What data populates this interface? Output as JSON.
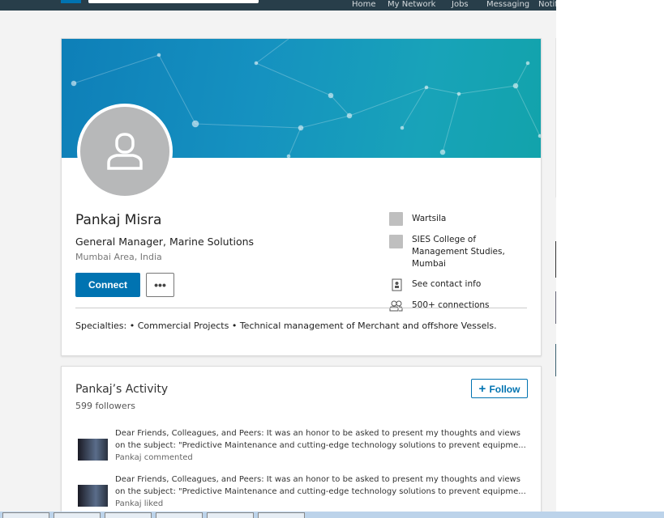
{
  "nav": {
    "items": [
      "Home",
      "My Network",
      "Jobs",
      "Messaging",
      "Notifi"
    ]
  },
  "profile": {
    "name": "Pankaj Misra",
    "headline": "General Manager, Marine Solutions",
    "location": "Mumbai Area, India",
    "connect_label": "Connect",
    "more_label": "•••",
    "company": "Wartsila",
    "school": "SIES College of Management Studies, Mumbai",
    "contact": "See contact info",
    "connections": "500+ connections",
    "specialties": "Specialties: • Commercial Projects • Technical management of Merchant and offshore Vessels."
  },
  "activity": {
    "title": "Pankaj’s Activity",
    "followers": "599 followers",
    "follow_label": "Follow",
    "items": [
      {
        "line1": "Dear Friends, Colleagues, and Peers:  It was an honor to be asked to present my thoughts and views",
        "line2": "on the subject:  \"Predictive Maintenance and cutting-edge technology solutions to prevent equipme...",
        "action": "Pankaj commented"
      },
      {
        "line1": "Dear Friends, Colleagues, and Peers:  It was an honor to be asked to present my thoughts and views",
        "line2": "on the subject:  \"Predictive Maintenance and cutting-edge technology solutions to prevent equipme...",
        "action": "Pankaj liked"
      }
    ]
  },
  "colors": {
    "brand": "#0073b1",
    "topbar": "#283e4a"
  }
}
